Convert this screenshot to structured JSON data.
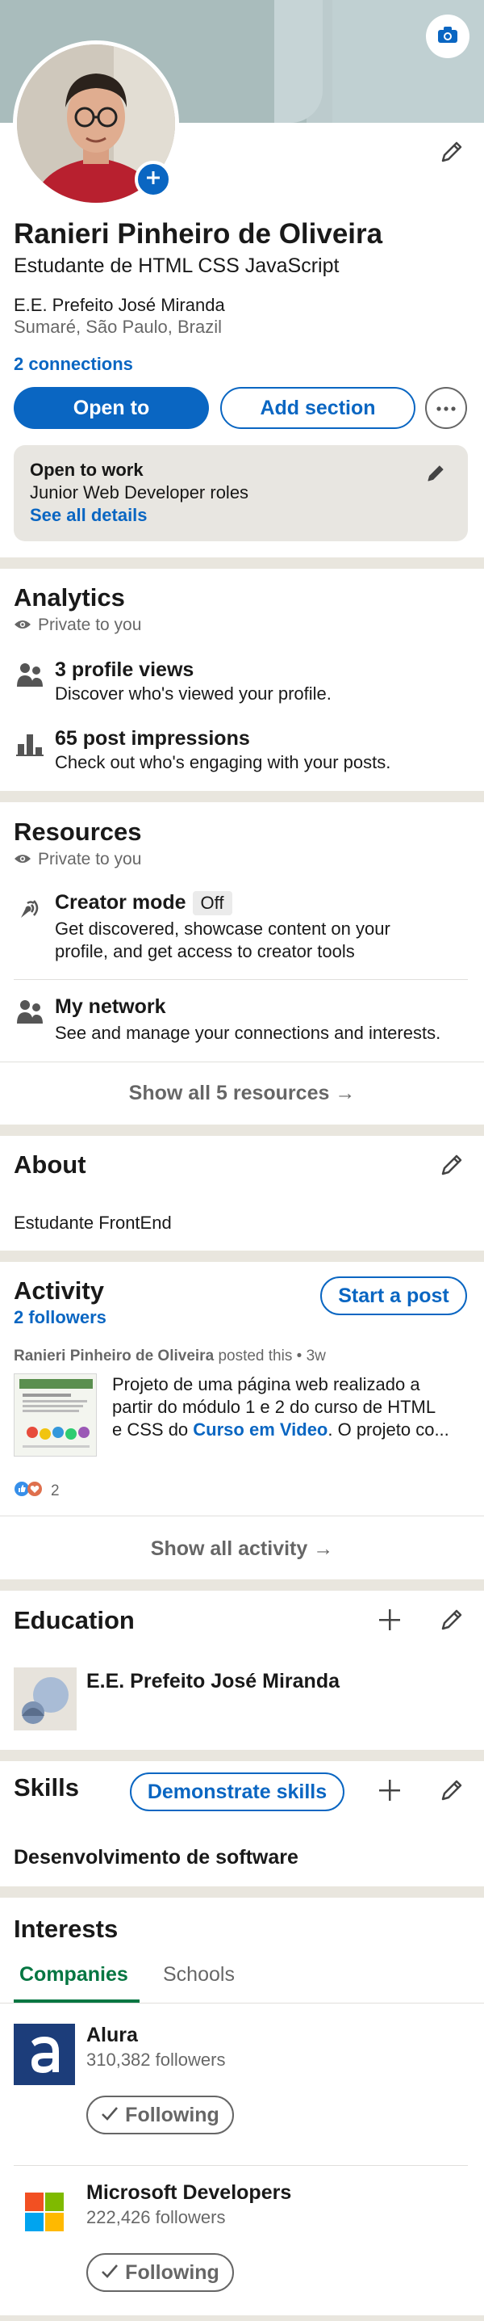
{
  "profile": {
    "name": "Ranieri Pinheiro de Oliveira",
    "headline": "Estudante de HTML CSS JavaScript",
    "school": "E.E. Prefeito José Miranda",
    "location": "Sumaré, São Paulo, Brazil",
    "connections": "2 connections",
    "open_to_label": "Open to",
    "add_section_label": "Add section",
    "more_icon": "ellipsis-icon",
    "camera_icon": "camera-icon",
    "edit_icon": "pencil-icon"
  },
  "open_to_work": {
    "title": "Open to work",
    "roles": "Junior Web Developer roles",
    "details_link": "See all details"
  },
  "analytics": {
    "title": "Analytics",
    "privacy": "Private to you",
    "items": [
      {
        "icon": "people-icon",
        "title": "3 profile views",
        "subtitle": "Discover who's viewed your profile."
      },
      {
        "icon": "bar-chart-icon",
        "title": "65 post impressions",
        "subtitle": "Check out who's engaging with your posts."
      }
    ]
  },
  "resources": {
    "title": "Resources",
    "privacy": "Private to you",
    "creator": {
      "title": "Creator mode",
      "badge": "Off",
      "subtitle_line1": "Get discovered, showcase content on your",
      "subtitle_line2": "profile, and get access to creator tools"
    },
    "network": {
      "title": "My network",
      "subtitle": "See and manage your connections and interests."
    },
    "show_all": "Show all 5 resources →"
  },
  "about": {
    "title": "About",
    "text": "Estudante FrontEnd"
  },
  "activity": {
    "title": "Activity",
    "followers": "2 followers",
    "start_post": "Start a post",
    "post_author": "Ranieri Pinheiro de Oliveira",
    "post_action": "posted this",
    "post_time": "3w",
    "post_line1": "Projeto de uma página web realizado a",
    "post_line2": "partir do módulo 1 e 2 do curso de HTML",
    "post_line3_pre": "e CSS do ",
    "post_line3_link": "Curso em Video",
    "post_line3_post": ". O projeto co...",
    "reactions_count": "2",
    "show_all": "Show all activity →"
  },
  "education": {
    "title": "Education",
    "school": "E.E. Prefeito José Miranda"
  },
  "skills": {
    "title": "Skills",
    "demonstrate": "Demonstrate skills",
    "skill": "Desenvolvimento de software"
  },
  "interests": {
    "title": "Interests",
    "tabs": [
      "Companies",
      "Schools"
    ],
    "companies": [
      {
        "name": "Alura",
        "followers": "310,382 followers",
        "button": "Following"
      },
      {
        "name": "Microsoft Developers",
        "followers": "222,426 followers",
        "button": "Following"
      }
    ]
  },
  "colors": {
    "accent": "#0a66c2",
    "active_tab": "#057642",
    "divider": "#e9e6de"
  }
}
